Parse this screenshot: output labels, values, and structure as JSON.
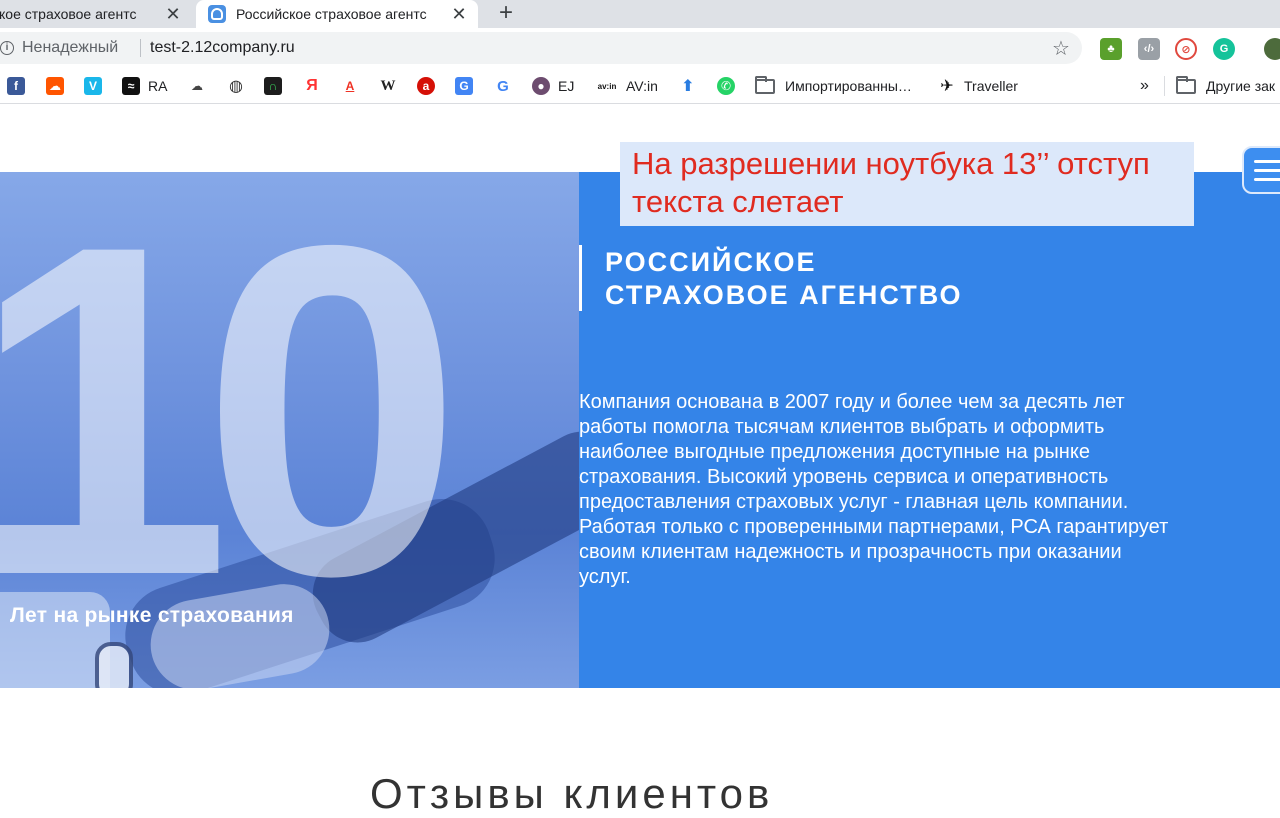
{
  "browser": {
    "tabs": [
      {
        "title": "ское страховое агентс",
        "active": false
      },
      {
        "title": "Российское страховое агентс",
        "active": true
      }
    ],
    "close_glyph": "✕",
    "new_tab_glyph": "+",
    "security_label": "Ненадежный",
    "url": "test-2.12company.ru",
    "star_glyph": "☆",
    "bookmarks": [
      {
        "label": "",
        "icon": "facebook-icon",
        "color": "#3b5998",
        "glyph": "f"
      },
      {
        "label": "",
        "icon": "soundcloud-icon",
        "color": "#ff5500",
        "glyph": "☁"
      },
      {
        "label": "",
        "icon": "vimeo-icon",
        "color": "#1ab7ea",
        "glyph": "V"
      },
      {
        "label": "RA",
        "icon": "ra-icon",
        "color": "#111111",
        "glyph": "≈"
      },
      {
        "label": "",
        "icon": "cloud-icon",
        "color": "#444444",
        "glyph": "☁"
      },
      {
        "label": "",
        "icon": "globe-icon",
        "color": "#333333",
        "glyph": "◍"
      },
      {
        "label": "",
        "icon": "headphones-icon",
        "color": "#1d1d1d",
        "glyph": "∩"
      },
      {
        "label": "",
        "icon": "yandex-icon",
        "color": "#ffffff",
        "glyph": "Я"
      },
      {
        "label": "",
        "icon": "alfa-icon",
        "color": "#ffffff",
        "glyph": "A"
      },
      {
        "label": "",
        "icon": "wikipedia-icon",
        "color": "#ffffff",
        "glyph": "W"
      },
      {
        "label": "",
        "icon": "lastfm-icon",
        "color": "#d51007",
        "glyph": "a"
      },
      {
        "label": "",
        "icon": "translate-icon",
        "color": "#4285f4",
        "glyph": "G"
      },
      {
        "label": "",
        "icon": "google-icon",
        "color": "#ffffff",
        "glyph": "G"
      },
      {
        "label": "EJ",
        "icon": "ej-icon",
        "color": "#6d4c6f",
        "glyph": "●"
      },
      {
        "label": "AV:in",
        "icon": "avin-icon",
        "color": "#ffffff",
        "glyph": "av:in"
      },
      {
        "label": "",
        "icon": "arrow-up-icon",
        "color": "#ffffff",
        "glyph": "⬆"
      },
      {
        "label": "",
        "icon": "whatsapp-icon",
        "color": "#25d366",
        "glyph": "✆"
      },
      {
        "label": "Импортированны…",
        "icon": "folder-icon",
        "color": "",
        "glyph": ""
      },
      {
        "label": "Traveller",
        "icon": "plane-icon",
        "color": "#ffffff",
        "glyph": "✈"
      }
    ],
    "overflow_label": "»",
    "other_bookmarks_label": "Другие зак"
  },
  "page": {
    "years_number": "10",
    "years_caption": "Лет на рынке страхования",
    "company_title_line1": "РОССИЙСКОЕ",
    "company_title_line2": "СТРАХОВОЕ АГЕНСТВО",
    "description": "Компания основана в 2007 году и более чем за десять лет работы помогла тысячам клиентов выбрать и оформить наиболее выгодные предложения доступные на рынке страхования. Высокий уровень сервиса и оперативность предоставления страховых услуг - главная цель компании. Работая только с проверенными партнерами, РСА гарантирует своим клиентам надежность и прозрачность при оказании услуг.",
    "annotation_line1": "На разрешении ноутбука 13’’ отступ",
    "annotation_line2": "текста слетает",
    "reviews_title": "Отзывы клиентов"
  },
  "colors": {
    "hero_blue": "#3484e8",
    "annotation_red": "#e02b20",
    "annotation_background": "#dce8fa"
  }
}
